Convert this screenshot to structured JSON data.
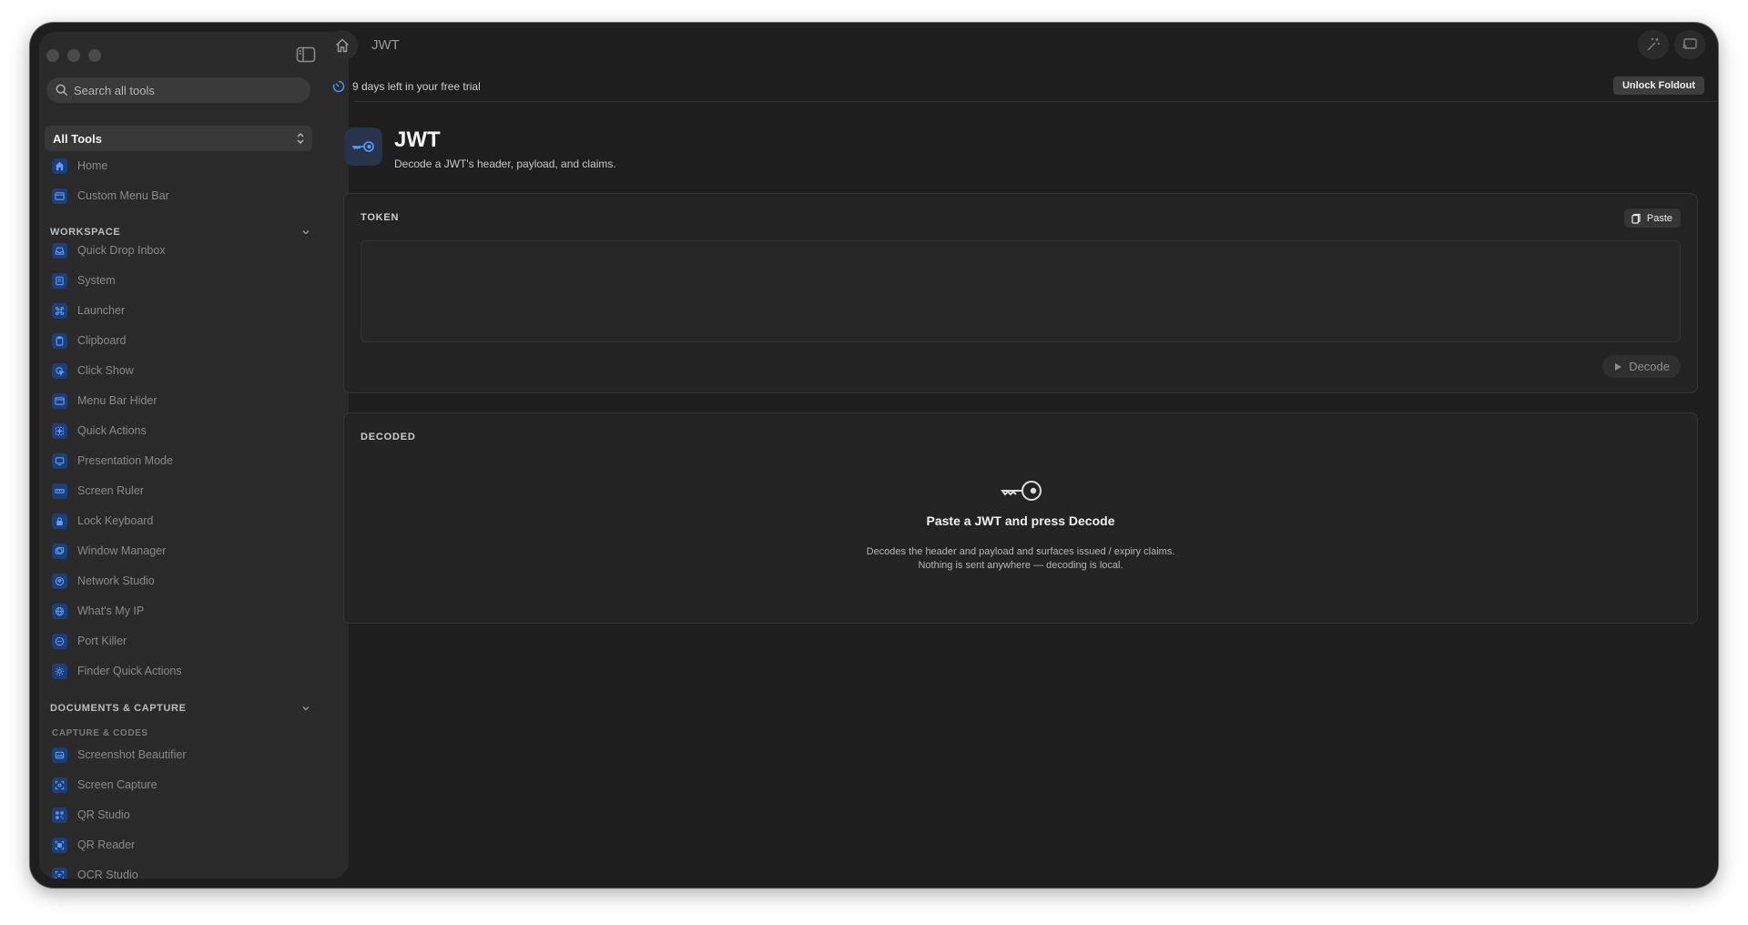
{
  "sidebar": {
    "search_placeholder": "Search all tools",
    "select_label": "All Tools",
    "top_items": [
      {
        "label": "Home",
        "icon": "house-icon"
      },
      {
        "label": "Custom Menu Bar",
        "icon": "menubar-icon"
      }
    ],
    "sections": [
      {
        "title": "WORKSPACE",
        "items": [
          {
            "label": "Quick Drop Inbox"
          },
          {
            "label": "System"
          },
          {
            "label": "Launcher"
          },
          {
            "label": "Clipboard"
          },
          {
            "label": "Click Show"
          },
          {
            "label": "Menu Bar Hider"
          },
          {
            "label": "Quick Actions"
          },
          {
            "label": "Presentation Mode"
          },
          {
            "label": "Screen Ruler"
          },
          {
            "label": "Lock Keyboard"
          },
          {
            "label": "Window Manager"
          },
          {
            "label": "Network Studio"
          },
          {
            "label": "What's My IP"
          },
          {
            "label": "Port Killer"
          },
          {
            "label": "Finder Quick Actions"
          }
        ]
      },
      {
        "title": "DOCUMENTS & CAPTURE",
        "subheader": "CAPTURE & CODES",
        "items": [
          {
            "label": "Screenshot Beautifier"
          },
          {
            "label": "Screen Capture"
          },
          {
            "label": "QR Studio"
          },
          {
            "label": "QR Reader"
          },
          {
            "label": "OCR Studio"
          }
        ]
      }
    ]
  },
  "topbar": {
    "breadcrumb": "JWT"
  },
  "trial": {
    "text": "9 days left in your free trial",
    "unlock_label": "Unlock Foldout"
  },
  "tool": {
    "title": "JWT",
    "subtitle": "Decode a JWT's header, payload, and claims."
  },
  "token_panel": {
    "label": "TOKEN",
    "paste_label": "Paste",
    "value": "",
    "decode_label": "Decode"
  },
  "decoded_panel": {
    "label": "DECODED",
    "empty_title": "Paste a JWT and press Decode",
    "empty_desc": "Decodes the header and payload and surfaces issued / expiry claims. Nothing is sent anywhere — decoding is local."
  },
  "colors": {
    "accent": "#4b8ff7",
    "icon_bg": "#1d3f78",
    "window_bg": "#1e1e1e",
    "sidebar_bg": "#2a2a2a"
  }
}
